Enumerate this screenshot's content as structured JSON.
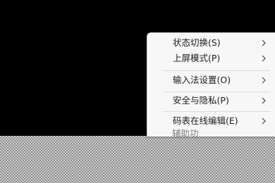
{
  "context_menu": {
    "items": [
      {
        "label": "状态切换(S)",
        "chevron": "chevron-right-icon"
      },
      {
        "label": "上屏模式(P)",
        "chevron": "chevron-right-icon"
      },
      {
        "label": "输入法设置(O)",
        "chevron": "chevron-right-icon"
      },
      {
        "label": "安全与隐私(P)",
        "chevron": "chevron-right-icon"
      },
      {
        "label": "码表在线编辑(E)",
        "chevron": "chevron-right-icon"
      }
    ],
    "partial_item_label": "辅助功"
  },
  "colors": {
    "desktop": "#000000",
    "menu_background": "#f7f7f7",
    "menu_text": "#1c1c1c",
    "separator": "#dadada"
  }
}
